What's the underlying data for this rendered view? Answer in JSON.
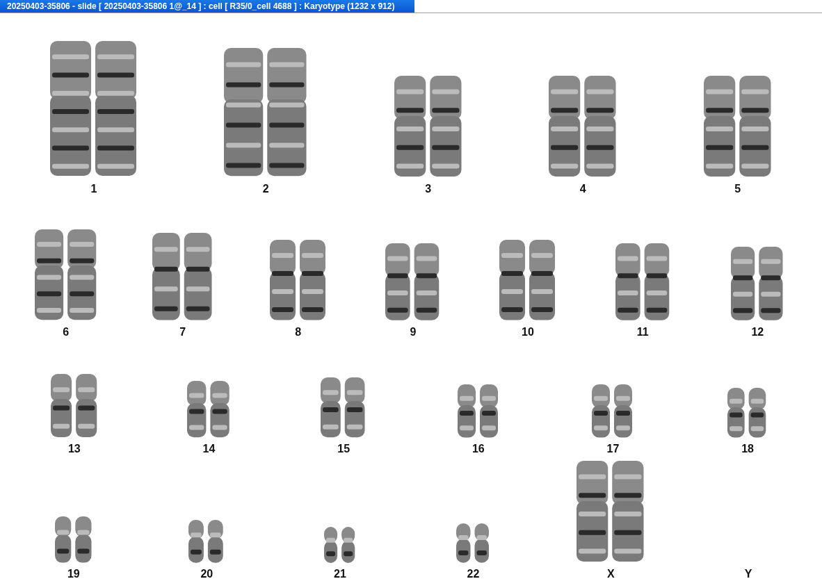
{
  "window": {
    "title": "20250403-35806 - slide [ 20250403-35806 1@_14 ] : cell [ R35/0_cell 4688 ] : Karyotype  (1232 x 912)"
  },
  "karyotype": {
    "rows": [
      {
        "groups": [
          {
            "label": "1",
            "kind": "pair"
          },
          {
            "label": "2",
            "kind": "pair"
          },
          {
            "label": "3",
            "kind": "pair"
          },
          {
            "label": "4",
            "kind": "pair"
          },
          {
            "label": "5",
            "kind": "pair"
          }
        ]
      },
      {
        "groups": [
          {
            "label": "6",
            "kind": "pair"
          },
          {
            "label": "7",
            "kind": "pair"
          },
          {
            "label": "8",
            "kind": "pair"
          },
          {
            "label": "9",
            "kind": "pair"
          },
          {
            "label": "10",
            "kind": "pair"
          },
          {
            "label": "11",
            "kind": "pair"
          },
          {
            "label": "12",
            "kind": "pair"
          }
        ]
      },
      {
        "groups": [
          {
            "label": "13",
            "kind": "pair"
          },
          {
            "label": "14",
            "kind": "pair"
          },
          {
            "label": "15",
            "kind": "pair"
          },
          {
            "label": "16",
            "kind": "pair"
          },
          {
            "label": "17",
            "kind": "pair"
          },
          {
            "label": "18",
            "kind": "pair"
          }
        ]
      },
      {
        "groups": [
          {
            "label": "19",
            "kind": "pair"
          },
          {
            "label": "20",
            "kind": "pair"
          },
          {
            "label": "21",
            "kind": "pair"
          },
          {
            "label": "22",
            "kind": "pair"
          },
          {
            "label": "X",
            "kind": "pair"
          },
          {
            "label": "Y",
            "kind": "empty"
          }
        ]
      }
    ]
  }
}
